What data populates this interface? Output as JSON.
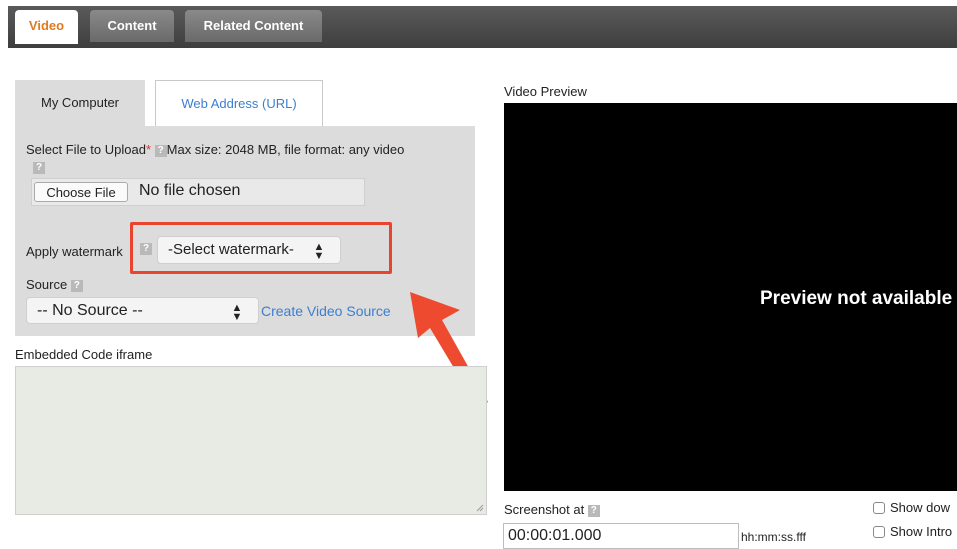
{
  "top_tabs": [
    {
      "label": "Video",
      "active": true
    },
    {
      "label": "Content",
      "active": false
    },
    {
      "label": "Related Content",
      "active": false
    }
  ],
  "upload": {
    "tabs": [
      {
        "label": "My Computer",
        "active": true
      },
      {
        "label": "Web Address (URL)",
        "active": false
      }
    ],
    "select_file_label": "Select File to Upload",
    "required_mark": "*",
    "max_size_text": "Max size: 2048 MB, file format: any video",
    "choose_file_button": "Choose File",
    "no_file_text": "No file chosen",
    "watermark_label": "Apply watermark",
    "watermark_select": "-Select watermark-",
    "source_label": "Source",
    "source_select": "-- No Source --",
    "create_source_link": "Create Video Source"
  },
  "embedded_label": "Embedded Code iframe",
  "preview": {
    "label": "Video Preview",
    "not_available": "Preview not available"
  },
  "screenshot": {
    "label": "Screenshot at",
    "value": "00:00:01.000",
    "format_hint": "hh:mm:ss.fff"
  },
  "options": {
    "show_download": "Show dow",
    "show_intro": "Show Intro"
  },
  "help_glyph": "?",
  "select_arrows": "▲▼",
  "colors": {
    "accent_tab": "#e07a1f",
    "link": "#3b7fd1",
    "highlight": "#e9442f",
    "arrow": "#ee4a2f"
  }
}
